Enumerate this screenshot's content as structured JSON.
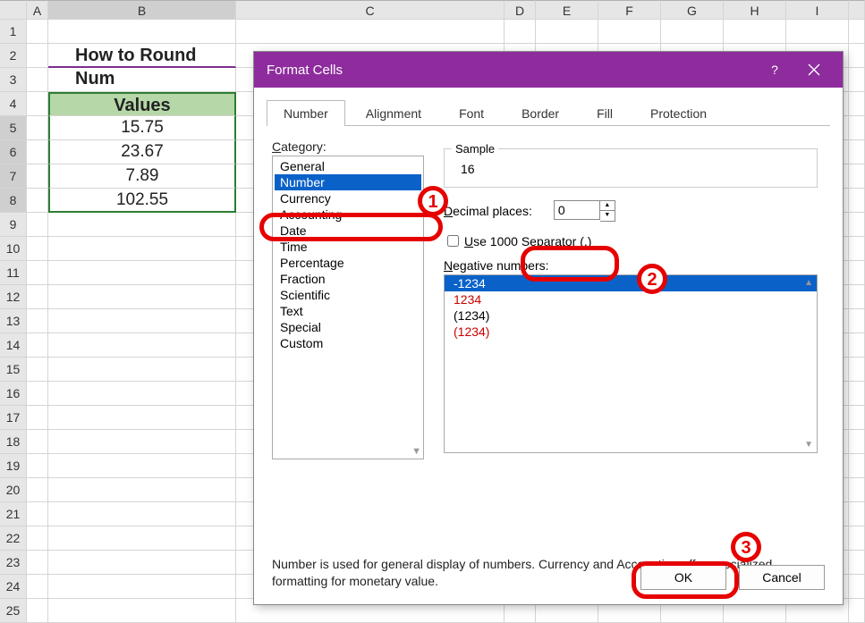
{
  "sheet": {
    "columns": [
      "",
      "A",
      "B",
      "C",
      "D",
      "E",
      "F",
      "G",
      "H",
      "I"
    ],
    "title_partial": "How to Round Num",
    "header": "Values",
    "values": [
      "15.75",
      "23.67",
      "7.89",
      "102.55"
    ]
  },
  "dialog": {
    "title": "Format Cells",
    "help": "?",
    "tabs": [
      "Number",
      "Alignment",
      "Font",
      "Border",
      "Fill",
      "Protection"
    ],
    "active_tab": 0,
    "category_label": "Category:",
    "categories": [
      "General",
      "Number",
      "Currency",
      "Accounting",
      "Date",
      "Time",
      "Percentage",
      "Fraction",
      "Scientific",
      "Text",
      "Special",
      "Custom"
    ],
    "selected_category": 1,
    "sample_label": "Sample",
    "sample_value": "16",
    "decimal_label": "Decimal places:",
    "decimal_value": "0",
    "separator_label": "Use 1000 Separator (,)",
    "separator_checked": false,
    "negative_label": "Negative numbers:",
    "negative_options": [
      {
        "text": "-1234",
        "red": false
      },
      {
        "text": "1234",
        "red": true
      },
      {
        "text": "(1234)",
        "red": false
      },
      {
        "text": "(1234)",
        "red": true
      }
    ],
    "negative_selected": 0,
    "description": "Number is used for general display of numbers.  Currency and Accounting offer specialized formatting for monetary value.",
    "ok": "OK",
    "cancel": "Cancel"
  },
  "annotations": {
    "n1": "1",
    "n2": "2",
    "n3": "3"
  }
}
